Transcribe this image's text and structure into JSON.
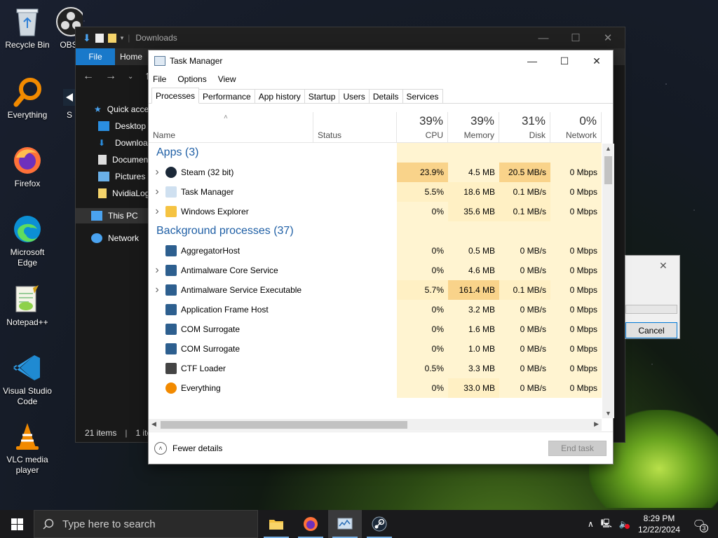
{
  "desktop": {
    "icons": [
      {
        "label": "Recycle Bin",
        "icon": "recycle-bin-icon"
      },
      {
        "label": "OBS",
        "icon": "obs-icon"
      },
      {
        "label": "Everything",
        "icon": "everything-icon"
      },
      {
        "label": "S",
        "icon": "steam-shortcut-icon"
      },
      {
        "label": "Firefox",
        "icon": "firefox-icon"
      },
      {
        "label": "Microsoft Edge",
        "icon": "edge-icon"
      },
      {
        "label": "Notepad++",
        "icon": "notepadpp-icon"
      },
      {
        "label": "Visual Studio Code",
        "icon": "vscode-icon"
      },
      {
        "label": "VLC media player",
        "icon": "vlc-icon"
      }
    ]
  },
  "explorer": {
    "title": "Downloads",
    "ribbon": {
      "file": "File",
      "home": "Home"
    },
    "nav": {
      "quick_access": "Quick acce",
      "items": [
        "Desktop",
        "Download",
        "Documen",
        "Pictures",
        "NvidiaLog"
      ],
      "this_pc": "This PC",
      "network": "Network"
    },
    "status": {
      "items": "21 items",
      "selected": "1 ite"
    }
  },
  "dialog": {
    "cancel": "Cancel"
  },
  "task_manager": {
    "title": "Task Manager",
    "menu": [
      "File",
      "Options",
      "View"
    ],
    "tabs": [
      "Processes",
      "Performance",
      "App history",
      "Startup",
      "Users",
      "Details",
      "Services"
    ],
    "active_tab": "Processes",
    "columns": {
      "name": "Name",
      "status": "Status",
      "cpu": {
        "pct": "39%",
        "label": "CPU"
      },
      "memory": {
        "pct": "39%",
        "label": "Memory"
      },
      "disk": {
        "pct": "31%",
        "label": "Disk"
      },
      "network": {
        "pct": "0%",
        "label": "Network"
      }
    },
    "groups": {
      "apps": "Apps (3)",
      "background": "Background processes (37)"
    },
    "apps": [
      {
        "name": "Steam (32 bit)",
        "cpu": "23.9%",
        "memory": "4.5 MB",
        "disk": "20.5 MB/s",
        "network": "0 Mbps",
        "expandable": true,
        "icon": "steam-icon"
      },
      {
        "name": "Task Manager",
        "cpu": "5.5%",
        "memory": "18.6 MB",
        "disk": "0.1 MB/s",
        "network": "0 Mbps",
        "expandable": true,
        "icon": "task-manager-icon"
      },
      {
        "name": "Windows Explorer",
        "cpu": "0%",
        "memory": "35.6 MB",
        "disk": "0.1 MB/s",
        "network": "0 Mbps",
        "expandable": true,
        "icon": "explorer-icon"
      }
    ],
    "background": [
      {
        "name": "AggregatorHost",
        "cpu": "0%",
        "memory": "0.5 MB",
        "disk": "0 MB/s",
        "network": "0 Mbps",
        "expandable": false,
        "icon": "process-icon"
      },
      {
        "name": "Antimalware Core Service",
        "cpu": "0%",
        "memory": "4.6 MB",
        "disk": "0 MB/s",
        "network": "0 Mbps",
        "expandable": true,
        "icon": "process-icon"
      },
      {
        "name": "Antimalware Service Executable",
        "cpu": "5.7%",
        "memory": "161.4 MB",
        "disk": "0.1 MB/s",
        "network": "0 Mbps",
        "expandable": true,
        "icon": "process-icon"
      },
      {
        "name": "Application Frame Host",
        "cpu": "0%",
        "memory": "3.2 MB",
        "disk": "0 MB/s",
        "network": "0 Mbps",
        "expandable": false,
        "icon": "process-icon"
      },
      {
        "name": "COM Surrogate",
        "cpu": "0%",
        "memory": "1.6 MB",
        "disk": "0 MB/s",
        "network": "0 Mbps",
        "expandable": false,
        "icon": "process-icon"
      },
      {
        "name": "COM Surrogate",
        "cpu": "0%",
        "memory": "1.0 MB",
        "disk": "0 MB/s",
        "network": "0 Mbps",
        "expandable": false,
        "icon": "process-icon"
      },
      {
        "name": "CTF Loader",
        "cpu": "0.5%",
        "memory": "3.3 MB",
        "disk": "0 MB/s",
        "network": "0 Mbps",
        "expandable": false,
        "icon": "ctf-icon"
      },
      {
        "name": "Everything",
        "cpu": "0%",
        "memory": "33.0 MB",
        "disk": "0 MB/s",
        "network": "0 Mbps",
        "expandable": false,
        "icon": "everything-icon"
      }
    ],
    "footer": {
      "fewer_details": "Fewer details",
      "end_task": "End task"
    }
  },
  "taskbar": {
    "search_placeholder": "Type here to search",
    "clock": {
      "time": "8:29 PM",
      "date": "12/22/2024"
    },
    "notification_count": "3"
  },
  "colors": {
    "cpu_high": "#f9d38a",
    "cell_mid": "#fff0c4",
    "cell_low": "#fff4d1",
    "group_blue": "#1f5fa5",
    "accent": "#0078d7"
  }
}
